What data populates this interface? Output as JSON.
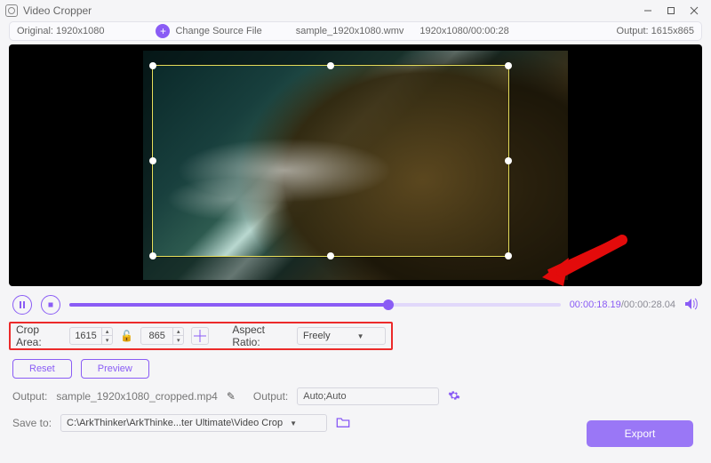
{
  "window": {
    "title": "Video Cropper"
  },
  "infobar": {
    "original_label": "Original:",
    "original_value": "1920x1080",
    "change_source_label": "Change Source File",
    "sample_name": "sample_1920x1080.wmv",
    "sample_time": "1920x1080/00:00:28",
    "output_label": "Output:",
    "output_value": "1615x865"
  },
  "playback": {
    "position_pct": 65,
    "current": "00:00:18.19",
    "duration": "00:00:28.04"
  },
  "crop": {
    "label": "Crop Area:",
    "width": "1615",
    "height": "865",
    "aspect_label": "Aspect Ratio:",
    "aspect_value": "Freely"
  },
  "buttons": {
    "reset": "Reset",
    "preview": "Preview",
    "export": "Export"
  },
  "output": {
    "label1": "Output:",
    "file": "sample_1920x1080_cropped.mp4",
    "label2": "Output:",
    "mode": "Auto;Auto"
  },
  "save": {
    "label": "Save to:",
    "path": "C:\\ArkThinker\\ArkThinke...ter Ultimate\\Video Crop"
  },
  "colors": {
    "accent": "#8a5cf5",
    "highlight_border": "#ec2a2a"
  }
}
